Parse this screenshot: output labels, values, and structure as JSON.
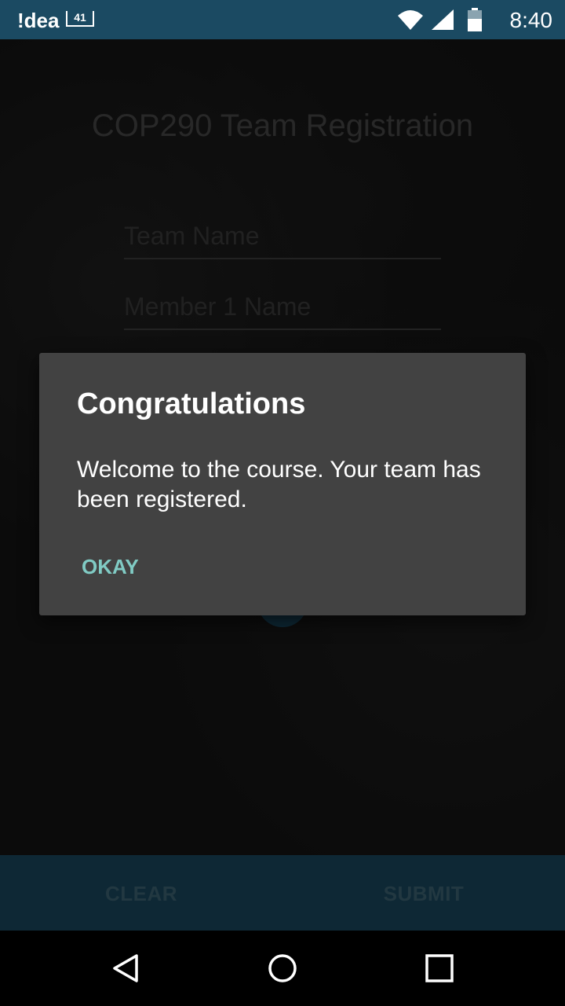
{
  "status_bar": {
    "carrier": "!dea",
    "sim_badge": "41",
    "time": "8:40",
    "icons": [
      "wifi-icon",
      "signal-icon",
      "battery-icon"
    ]
  },
  "form": {
    "title": "COP290 Team Registration",
    "team_name_placeholder": "Team Name",
    "member1_placeholder": "Member 1 Name"
  },
  "bottom_bar": {
    "clear_label": "CLEAR",
    "submit_label": "SUBMIT"
  },
  "dialog": {
    "title": "Congratulations",
    "message": "Welcome to the course. Your team has been registered.",
    "ok_label": "OKAY"
  },
  "nav_bar": {
    "icons": [
      "back-icon",
      "home-icon",
      "recents-icon"
    ]
  },
  "colors": {
    "primary": "#1b4a62",
    "dialog_bg": "#424242",
    "accent": "#80cbc4"
  }
}
